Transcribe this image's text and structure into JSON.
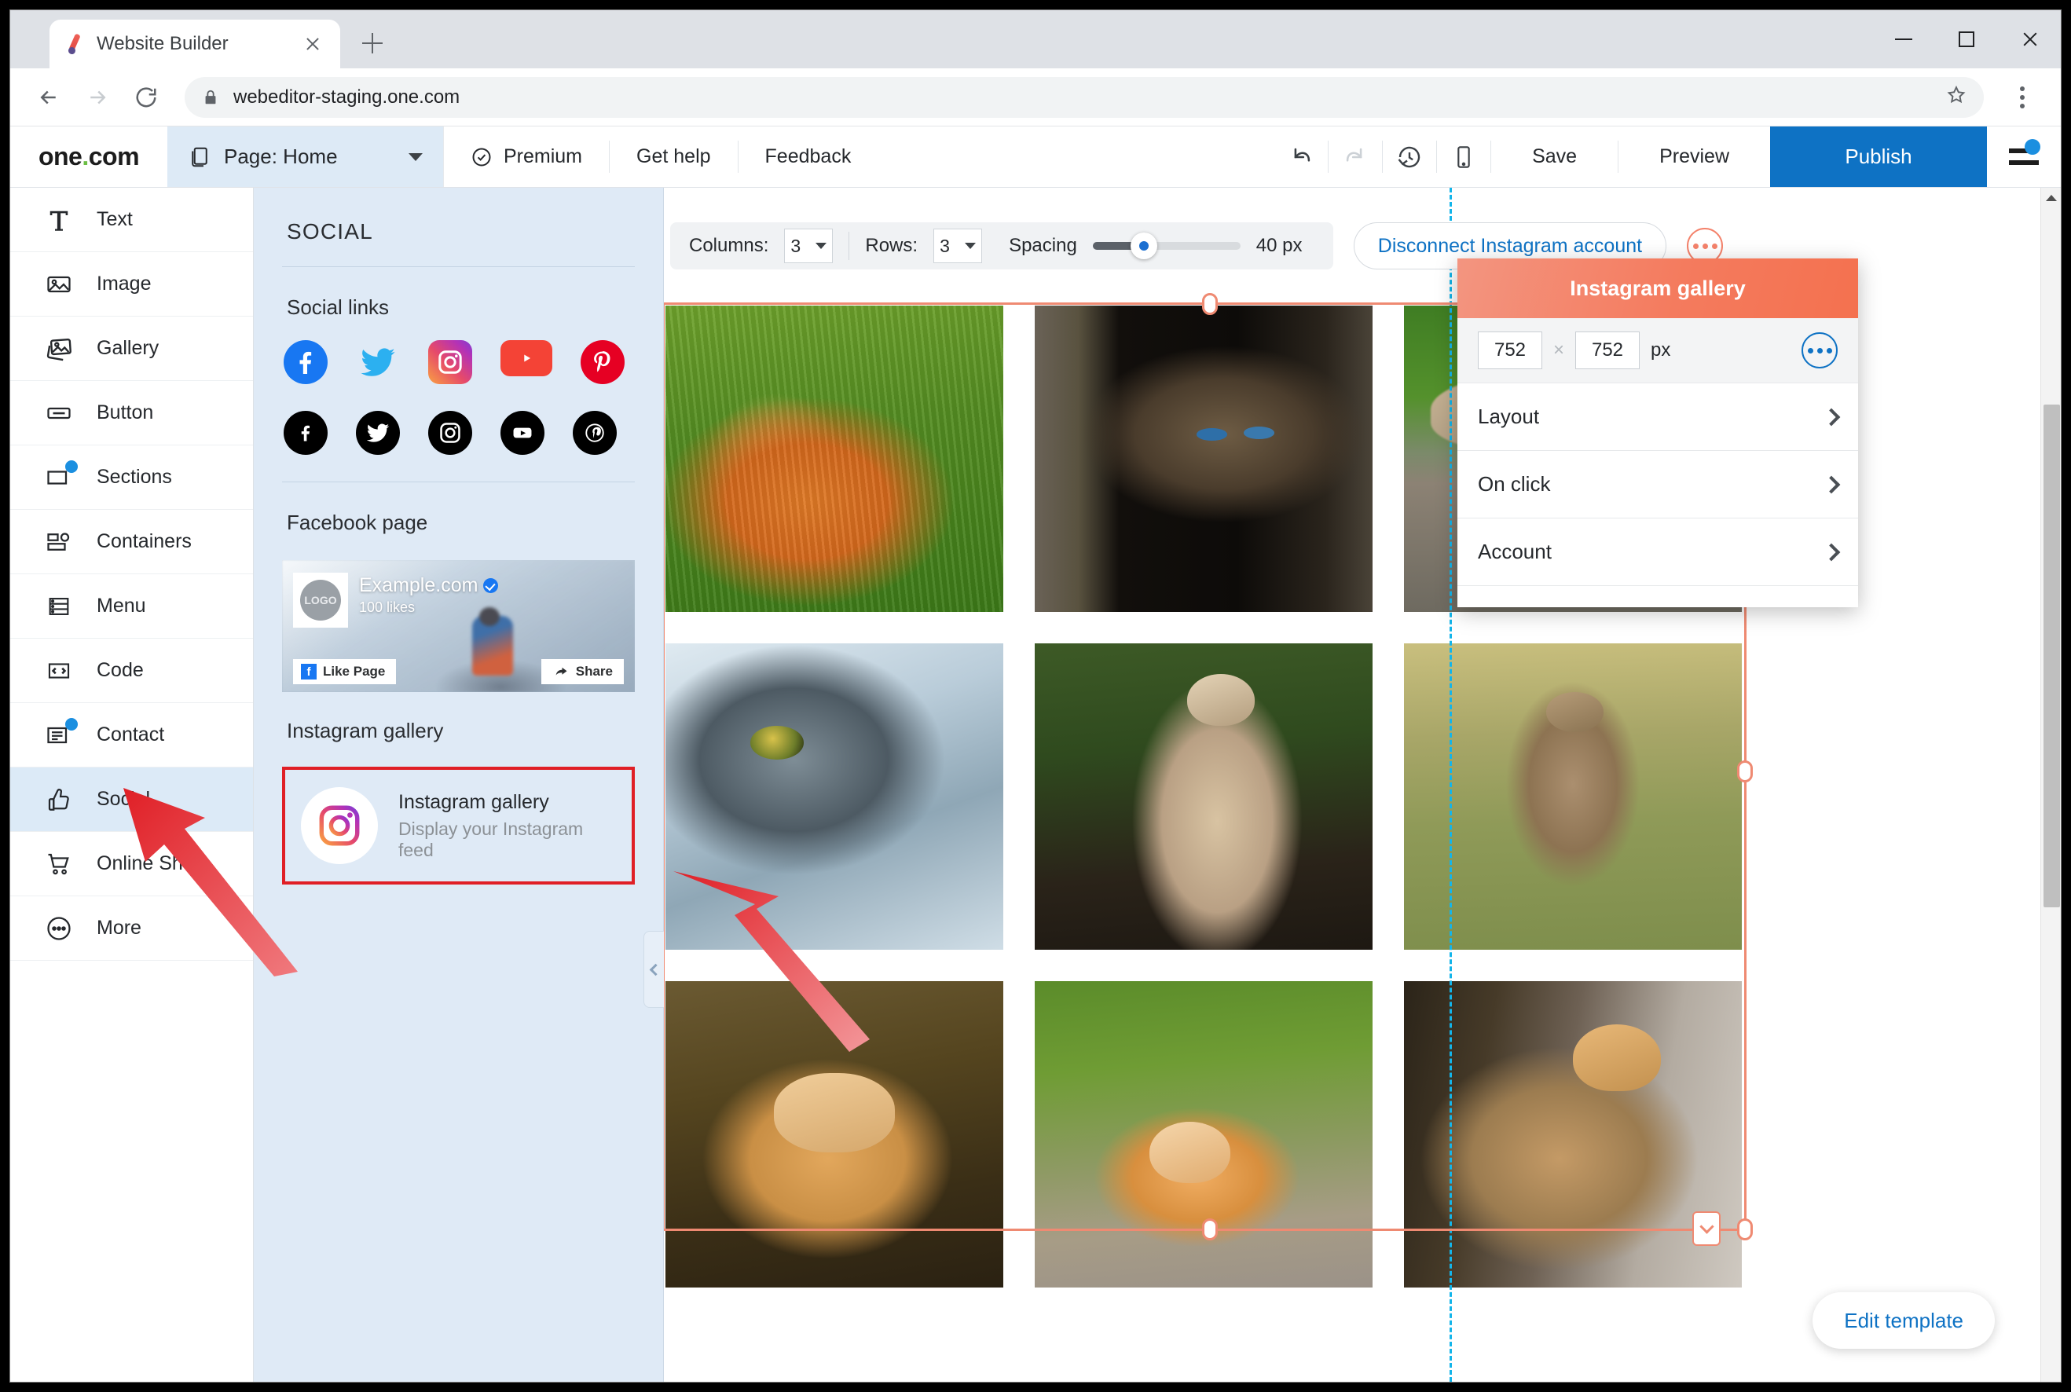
{
  "browser": {
    "tab_title": "Website Builder",
    "tab_favicon": "paintbrush-icon",
    "url": "webeditor-staging.one.com",
    "new_tab_label": "+",
    "window_controls": {
      "minimize": "minimize-icon",
      "maximize": "maximize-icon",
      "close": "close-icon"
    }
  },
  "app_toolbar": {
    "logo_text": "one",
    "logo_dot": ".",
    "logo_suffix": "com",
    "page_selector": "Page: Home",
    "items": [
      {
        "label": "Premium",
        "icon": "check-circle-icon"
      },
      {
        "label": "Get help",
        "icon": ""
      },
      {
        "label": "Feedback",
        "icon": ""
      }
    ],
    "undo": "undo-icon",
    "redo": "redo-icon",
    "history": "history-clock-icon",
    "mobile_preview": "mobile-device-icon",
    "save_label": "Save",
    "preview_label": "Preview",
    "publish_label": "Publish",
    "menu_icon": "hamburger-menu-icon"
  },
  "sidebar": {
    "items": [
      {
        "label": "Text",
        "icon": "text-icon",
        "badge": false,
        "active": false
      },
      {
        "label": "Image",
        "icon": "image-icon",
        "badge": false,
        "active": false
      },
      {
        "label": "Gallery",
        "icon": "gallery-icon",
        "badge": false,
        "active": false
      },
      {
        "label": "Button",
        "icon": "button-icon",
        "badge": false,
        "active": false
      },
      {
        "label": "Sections",
        "icon": "sections-icon",
        "badge": true,
        "active": false
      },
      {
        "label": "Containers",
        "icon": "containers-icon",
        "badge": false,
        "active": false
      },
      {
        "label": "Menu",
        "icon": "menu-icon",
        "badge": false,
        "active": false
      },
      {
        "label": "Code",
        "icon": "code-icon",
        "badge": false,
        "active": false
      },
      {
        "label": "Contact",
        "icon": "contact-icon",
        "badge": true,
        "active": false
      },
      {
        "label": "Social",
        "icon": "thumbs-up-icon",
        "badge": false,
        "active": true
      },
      {
        "label": "Online Shop",
        "icon": "shopping-cart-icon",
        "badge": false,
        "active": false
      },
      {
        "label": "More",
        "icon": "more-circle-icon",
        "badge": false,
        "active": false
      }
    ]
  },
  "social_panel": {
    "title": "SOCIAL",
    "social_links_heading": "Social links",
    "colored_icons": [
      "facebook-icon",
      "twitter-icon",
      "instagram-icon",
      "youtube-icon",
      "pinterest-icon"
    ],
    "black_icons": [
      "facebook-icon",
      "twitter-icon",
      "instagram-icon",
      "youtube-icon",
      "pinterest-icon"
    ],
    "facebook_heading": "Facebook page",
    "facebook_preview": {
      "page_name": "Example.com",
      "verified": true,
      "likes": "100 likes",
      "logo_text": "LOGO",
      "like_button": "Like Page",
      "share_button": "Share"
    },
    "instagram_heading": "Instagram gallery",
    "instagram_card": {
      "title": "Instagram gallery",
      "subtitle": "Display your Instagram feed",
      "icon": "instagram-icon",
      "highlighted": true
    },
    "collapse_icon": "chevron-left-icon"
  },
  "grid_toolbar": {
    "columns_label": "Columns:",
    "columns_value": "3",
    "rows_label": "Rows:",
    "rows_value": "3",
    "spacing_label": "Spacing",
    "spacing_value": "40 px",
    "disconnect_label": "Disconnect Instagram account",
    "more_icon": "more-dots-icon"
  },
  "widget_panel": {
    "title": "Instagram gallery",
    "width": "752",
    "height": "752",
    "multiply": "×",
    "unit": "px",
    "more_icon": "more-dots-icon",
    "rows": [
      {
        "label": "Layout",
        "icon": "chevron-right-icon"
      },
      {
        "label": "On click",
        "icon": "chevron-right-icon"
      },
      {
        "label": "Account",
        "icon": "chevron-right-icon"
      }
    ]
  },
  "canvas": {
    "edit_template_label": "Edit template",
    "gallery": {
      "columns": 3,
      "rows": 3,
      "spacing_px": 40,
      "cells": [
        {
          "alt": "ginger-cat-in-grass",
          "style": "c1"
        },
        {
          "alt": "tabby-kitten-blue-eyes-dark",
          "style": "c2"
        },
        {
          "alt": "cat-jumping-on-wall-ivy",
          "style": "c3"
        },
        {
          "alt": "closeup-grey-white-cat-face",
          "style": "c4"
        },
        {
          "alt": "kitten-looking-up",
          "style": "c5"
        },
        {
          "alt": "tabby-cat-walking-on-grass",
          "style": "c6"
        },
        {
          "alt": "ginger-kitten-looking-at-camera",
          "style": "c7"
        },
        {
          "alt": "ginger-kitten-lying-in-grass",
          "style": "c8"
        },
        {
          "alt": "two-cats-by-stone-wall",
          "style": "c9"
        }
      ]
    }
  },
  "colors": {
    "publish_blue": "#0e72c4",
    "link_blue": "#0e72c4",
    "selection_salmon": "#ef8a72",
    "widget_header_orange": "#f47b5e",
    "highlight_red": "#e01f26",
    "badge_blue": "#1b8fe0",
    "guide_cyan": "#13b5ea",
    "logo_green": "#6cbe45",
    "panel_bg": "#dfeaf6",
    "active_rail": "#dceaf7"
  },
  "annotations": {
    "arrow_1": "red-arrow-pointing-to-social",
    "arrow_2": "red-arrow-pointing-to-instagram-gallery-card"
  }
}
